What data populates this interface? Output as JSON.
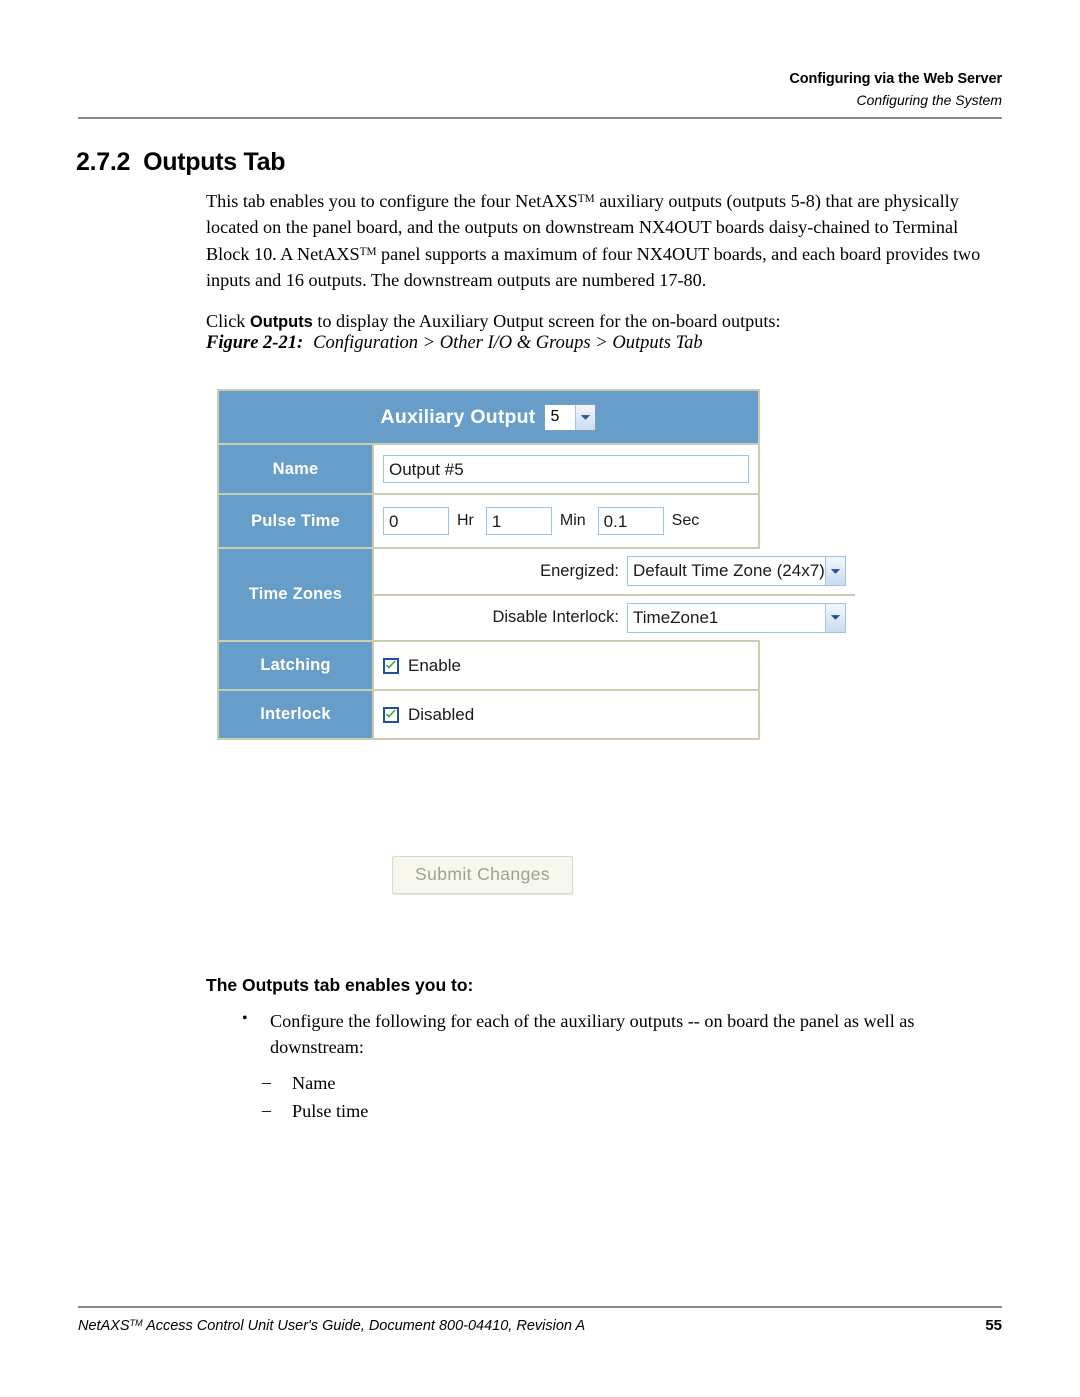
{
  "header": {
    "running_title": "Configuring via the Web Server",
    "running_subtitle": "Configuring the System"
  },
  "section": {
    "number": "2.7.2",
    "title": "Outputs Tab"
  },
  "body": {
    "paragraph_1_part1": "This tab enables you to configure the four NetAXS",
    "paragraph_1_tm1": "TM",
    "paragraph_1_part2": " auxiliary outputs (outputs 5-8) that are physically located on the panel board, and the outputs on downstream NX4OUT boards daisy-chained to Terminal Block 10. A NetAXS",
    "paragraph_1_tm2": "TM",
    "paragraph_1_part3": " panel supports a maximum of four NX4OUT boards, and each board provides two inputs and 16 outputs. The downstream outputs are numbered 17-80.",
    "paragraph_2_part1": "Click ",
    "paragraph_2_bold": "Outputs",
    "paragraph_2_part2": " to display the Auxiliary Output screen for the on-board outputs:"
  },
  "figure": {
    "number": "Figure 2-21:",
    "caption": "Configuration > Other I/O & Groups > Outputs Tab"
  },
  "screenshot": {
    "panel_title": "Auxiliary Output",
    "output_select_value": "5",
    "rows": {
      "name": {
        "label": "Name",
        "value": "Output #5"
      },
      "pulse_time": {
        "label": "Pulse Time",
        "hours_value": "0",
        "hours_unit": "Hr",
        "minutes_value": "1",
        "minutes_unit": "Min",
        "seconds_value": "0.1",
        "seconds_unit": "Sec"
      },
      "time_zones": {
        "label": "Time Zones",
        "energized_label": "Energized:",
        "energized_value": "Default Time Zone (24x7)",
        "disable_interlock_label": "Disable Interlock:",
        "disable_interlock_value": "TimeZone1"
      },
      "latching": {
        "label": "Latching",
        "checkbox_label": "Enable",
        "checked": true
      },
      "interlock": {
        "label": "Interlock",
        "checkbox_label": "Disabled",
        "checked": true
      }
    },
    "submit_label": "Submit Changes",
    "colors": {
      "panel_blue": "#669dc9",
      "panel_border": "#c9cfae",
      "input_border": "#9dc4e0",
      "check_green": "#34a832",
      "checkbox_border": "#2050a0",
      "submit_bg": "#f7f7ee",
      "submit_text": "#9aa58c"
    }
  },
  "lower": {
    "lead": "The Outputs tab enables you to:",
    "bullets": [
      "Configure the following for each of the auxiliary outputs -- on board the panel as well as downstream:"
    ],
    "dashes": [
      "Name",
      "Pulse time"
    ]
  },
  "footer": {
    "text_part1": "NetAXS",
    "text_tm": "TM",
    "text_part2": " Access Control Unit User's Guide, Document 800-04410, Revision A",
    "page_number": "55"
  }
}
